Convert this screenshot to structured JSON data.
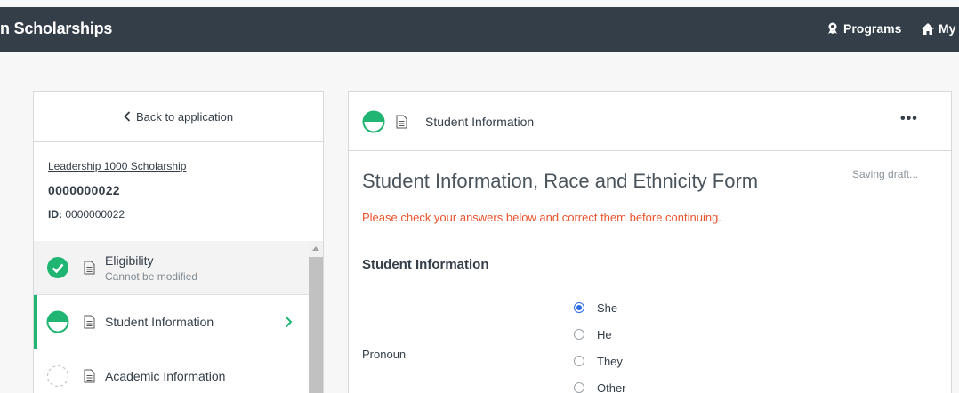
{
  "header": {
    "brand": "n Scholarships",
    "nav": [
      {
        "label": "Programs",
        "icon": "award-icon"
      },
      {
        "label": "My"
      }
    ]
  },
  "sidebar": {
    "back_label": "Back to application",
    "application": {
      "name": "Leadership 1000 Scholarship",
      "number": "0000000022",
      "id_label": "ID:",
      "id_value": "0000000022"
    },
    "steps": [
      {
        "title": "Eligibility",
        "subtitle": "Cannot be modified",
        "status": "complete"
      },
      {
        "title": "Student Information",
        "status": "in-progress"
      },
      {
        "title": "Academic Information",
        "status": "not-started"
      }
    ]
  },
  "main": {
    "header_title": "Student Information",
    "more_label": "•••",
    "form_title": "Student Information, Race and Ethnicity Form",
    "save_status": "Saving draft...",
    "error_message": "Please check your answers below and correct them before continuing.",
    "section_title": "Student Information",
    "pronoun": {
      "label": "Pronoun",
      "options": [
        "She",
        "He",
        "They",
        "Other"
      ],
      "selected": "She"
    }
  },
  "colors": {
    "topbar": "#333e48",
    "accent_green": "#21b573",
    "error": "#e8542c",
    "radio_selected": "#2d6ce6"
  }
}
